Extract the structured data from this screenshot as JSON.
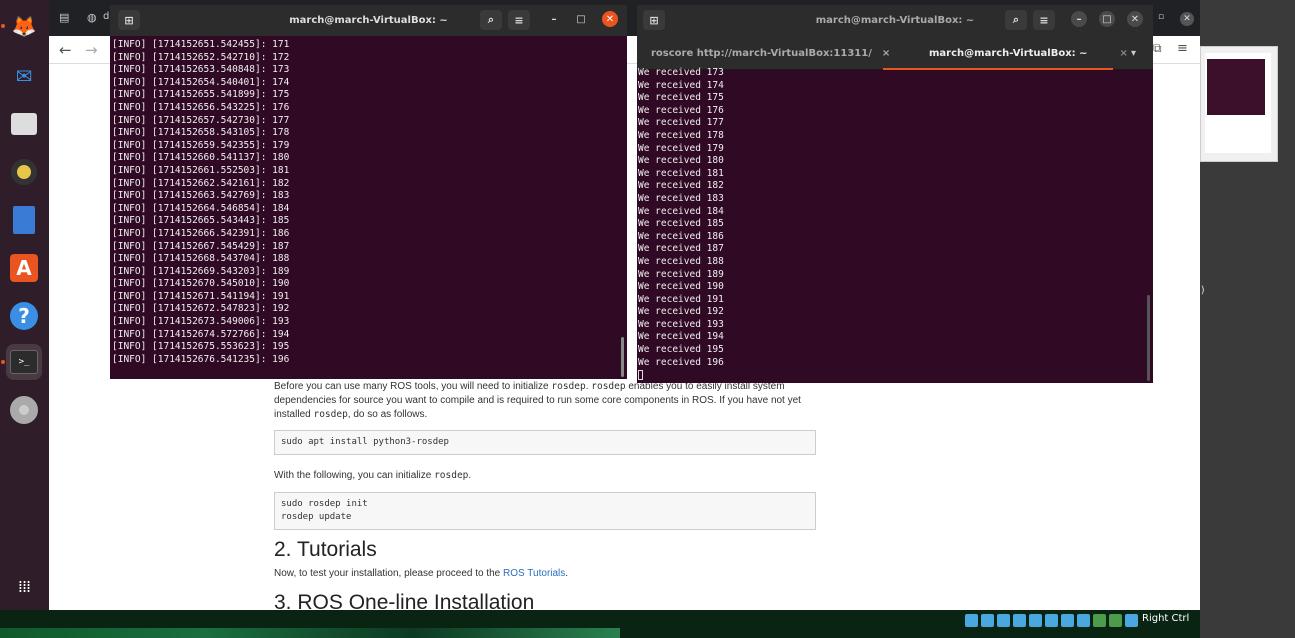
{
  "colors": {
    "terminal_bg": "#300a24",
    "accent": "#e95420",
    "link": "#2a6ebb"
  },
  "dock": {
    "items": [
      {
        "name": "firefox-icon",
        "glyph": "🦊"
      },
      {
        "name": "thunderbird-icon",
        "glyph": "✉"
      },
      {
        "name": "files-icon",
        "glyph": "🗂"
      },
      {
        "name": "rhythmbox-icon",
        "glyph": "◉"
      },
      {
        "name": "writer-icon",
        "glyph": "📄"
      },
      {
        "name": "software-icon",
        "glyph": "A"
      },
      {
        "name": "help-icon",
        "glyph": "?"
      },
      {
        "name": "terminal-icon",
        "glyph": ">_"
      },
      {
        "name": "disc-icon",
        "glyph": "◎"
      }
    ],
    "apps_grid_glyph": "⋮⋮⋮"
  },
  "browser": {
    "tab_partial": "d",
    "paragraph1_parts": {
      "a": "Before you can use many ROS tools, you will need to initialize ",
      "code1": "rosdep",
      "b": ". ",
      "code2": "rosdep",
      "c": " enables you to easily install system dependencies for source you want to compile and is required to run some core components in ROS. If you have not yet installed ",
      "code3": "rosdep",
      "d": ", do so as follows."
    },
    "code1": "sudo apt install python3-rosdep",
    "paragraph2_parts": {
      "a": "With the following, you can initialize ",
      "code": "rosdep",
      "b": "."
    },
    "code2_lines": [
      "sudo rosdep init",
      "rosdep update"
    ],
    "heading_tutorials": "2. Tutorials",
    "paragraph3_parts": {
      "a": "Now, to test your installation, please proceed to the ",
      "link": "ROS Tutorials",
      "b": "."
    },
    "heading_oneline": "3. ROS One-line Installation"
  },
  "terminal_left": {
    "title": "march@march-VirtualBox: ~",
    "lines": [
      "[INFO] [1714152651.542455]: 171",
      "[INFO] [1714152652.542710]: 172",
      "[INFO] [1714152653.540848]: 173",
      "[INFO] [1714152654.540401]: 174",
      "[INFO] [1714152655.541899]: 175",
      "[INFO] [1714152656.543225]: 176",
      "[INFO] [1714152657.542730]: 177",
      "[INFO] [1714152658.543105]: 178",
      "[INFO] [1714152659.542355]: 179",
      "[INFO] [1714152660.541137]: 180",
      "[INFO] [1714152661.552503]: 181",
      "[INFO] [1714152662.542161]: 182",
      "[INFO] [1714152663.542769]: 183",
      "[INFO] [1714152664.546854]: 184",
      "[INFO] [1714152665.543443]: 185",
      "[INFO] [1714152666.542391]: 186",
      "[INFO] [1714152667.545429]: 187",
      "[INFO] [1714152668.543704]: 188",
      "[INFO] [1714152669.543203]: 189",
      "[INFO] [1714152670.545010]: 190",
      "[INFO] [1714152671.541194]: 191",
      "[INFO] [1714152672.547823]: 192",
      "[INFO] [1714152673.549006]: 193",
      "[INFO] [1714152674.572766]: 194",
      "[INFO] [1714152675.553623]: 195",
      "[INFO] [1714152676.541235]: 196"
    ]
  },
  "terminal_right": {
    "title": "march@march-VirtualBox: ~",
    "tabs": [
      {
        "label": "roscore http://march-VirtualBox:11311/",
        "active": false
      },
      {
        "label": "march@march-VirtualBox: ~",
        "active": true
      }
    ],
    "lines": [
      "We received 173",
      "We received 174",
      "We received 175",
      "We received 176",
      "We received 177",
      "We received 178",
      "We received 179",
      "We received 180",
      "We received 181",
      "We received 182",
      "We received 183",
      "We received 184",
      "We received 185",
      "We received 186",
      "We received 187",
      "We received 188",
      "We received 189",
      "We received 190",
      "We received 191",
      "We received 192",
      "We received 193",
      "We received 194",
      "We received 195",
      "We received 196"
    ]
  },
  "vbox_status": {
    "host_key": "Right Ctrl"
  },
  "host": {
    "side_label": "l)"
  }
}
